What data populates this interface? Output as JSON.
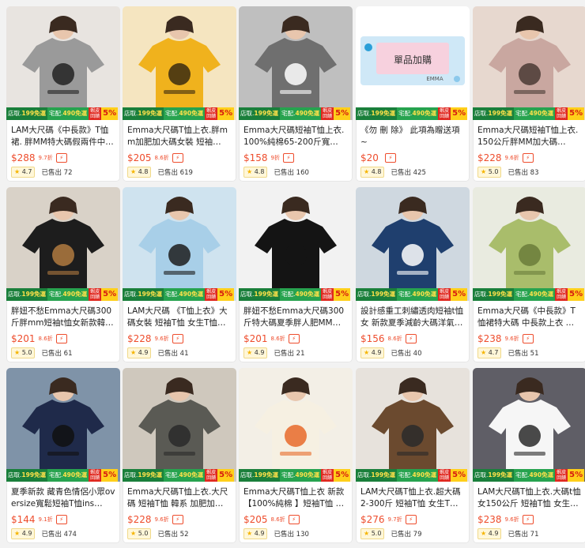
{
  "promo": {
    "shop_label": "店取",
    "shop_amount": "199免運",
    "home_label": "宅配",
    "home_amount": "490免運",
    "badge_top": "蝦皮",
    "badge_bottom": "回饋",
    "badge_pct": "5%"
  },
  "icons": {
    "star": "star-icon",
    "fast": "fast-shipping-icon"
  },
  "cards": [
    {
      "title": "LAM大尺碼《中長款》T恤裙. 胖MM特大碼假兩件中長…",
      "price": "$288",
      "discount": "9.7折",
      "rating": "4.7",
      "sold": "已售出 72",
      "img": {
        "bg": "#e8e4e0",
        "shirt": "#9a9a9a",
        "accent": "#222"
      }
    },
    {
      "title": "Emma大尺碼T恤上衣.胖mm加肥加大碼女裝 短袖…",
      "price": "$205",
      "discount": "8.6折",
      "rating": "4.8",
      "sold": "已售出 619",
      "img": {
        "bg": "#f5e5c0",
        "shirt": "#f0b21d",
        "accent": "#3a2a10"
      }
    },
    {
      "title": "Emma大尺碼短袖T恤上衣.100%純棉65-200斤寬…",
      "price": "$158",
      "discount": "9折",
      "rating": "4.8",
      "sold": "已售出 160",
      "img": {
        "bg": "#bfbfbf",
        "shirt": "#6f6f6f",
        "accent": "#ffffff"
      }
    },
    {
      "title": "《勿 刪 除》 此項為贈送項~",
      "price": "$20",
      "discount": "",
      "rating": "4.8",
      "sold": "已售出 425",
      "img": {
        "bg": "#ffffff",
        "shirt": "#f7d1de",
        "accent": "#2b9fd8"
      },
      "img_text": "單品加購",
      "img_sub": "EMMA"
    },
    {
      "title": "Emma大尺碼短袖T恤上衣.150公斤胖MM加大碼…",
      "price": "$228",
      "discount": "9.6折",
      "rating": "5.0",
      "sold": "已售出 83",
      "img": {
        "bg": "#e7d8cf",
        "shirt": "#c9a7a0",
        "accent": "#4a3a34"
      }
    },
    {
      "title": "胖妞不愁Emma大尺碼300斤胖mm短袖t恤女新款韓…",
      "price": "$201",
      "discount": "8.6折",
      "rating": "5.0",
      "sold": "已售出 61",
      "img": {
        "bg": "#d9d2c8",
        "shirt": "#1d1d1d",
        "accent": "#b07a3f"
      }
    },
    {
      "title": "LAM大尺碼 《T恤上衣》大碼女裝 短袖T恤 女生T恤…",
      "price": "$228",
      "discount": "9.6折",
      "rating": "4.9",
      "sold": "已售出 41",
      "img": {
        "bg": "#cfe3ef",
        "shirt": "#a8cfe8",
        "accent": "#1d1d1d"
      }
    },
    {
      "title": "胖妞不愁Emma大尺碼300斤特大碼夏季胖人肥MM…",
      "price": "$201",
      "discount": "8.6折",
      "rating": "4.9",
      "sold": "已售出 21",
      "img": {
        "bg": "#f2f2f2",
        "shirt": "#141414",
        "accent": "#141414"
      }
    },
    {
      "title": "設計感重工刺繡透肉短袖t恤女 新款夏季減齡大碼洋氣…",
      "price": "$156",
      "discount": "8.6折",
      "rating": "4.9",
      "sold": "已售出 40",
      "img": {
        "bg": "#cfd8e0",
        "shirt": "#1f3f6e",
        "accent": "#ffffff"
      }
    },
    {
      "title": "Emma大尺碼《中長款》T恤裙特大碼 中長款上衣 …",
      "price": "$238",
      "discount": "9.6折",
      "rating": "4.7",
      "sold": "已售出 51",
      "img": {
        "bg": "#e9ebe0",
        "shirt": "#a9bd6b",
        "accent": "#6b7c3a"
      }
    },
    {
      "title": "夏季新款 藏青色情侶小眾oversize寬鬆短袖T恤ins…",
      "price": "$144",
      "discount": "9.1折",
      "rating": "4.9",
      "sold": "已售出 474",
      "img": {
        "bg": "#7f93a8",
        "shirt": "#1f2a4a",
        "accent": "#111111"
      }
    },
    {
      "title": "Emma大尺碼T恤上衣.大尺碼 短袖T恤 韓系 加肥加…",
      "price": "$228",
      "discount": "9.6折",
      "rating": "5.0",
      "sold": "已售出 52",
      "img": {
        "bg": "#cfc8bd",
        "shirt": "#5a5a54",
        "accent": "#2a2a2a"
      }
    },
    {
      "title": "Emma大尺碼T恤上衣 新款【100%純棉 】短袖T恤 …",
      "price": "$205",
      "discount": "8.6折",
      "rating": "4.9",
      "sold": "已售出 130",
      "img": {
        "bg": "#f3efe6",
        "shirt": "#f6f0e2",
        "accent": "#e86a2a"
      }
    },
    {
      "title": "LAM大尺碼T恤上衣.超大碼2-300斤 短袖T恤 女生T恤…",
      "price": "$276",
      "discount": "9.7折",
      "rating": "5.0",
      "sold": "已售出 79",
      "img": {
        "bg": "#e7e2dc",
        "shirt": "#6b4a2f",
        "accent": "#2a2a2a"
      }
    },
    {
      "title": "LAM大尺碼T恤上衣.大碼t恤女150公斤 短袖T恤 女生…",
      "price": "$238",
      "discount": "9.6折",
      "rating": "4.9",
      "sold": "已售出 71",
      "img": {
        "bg": "#5f5e66",
        "shirt": "#f6f6f6",
        "accent": "#2a2a2a"
      }
    }
  ]
}
